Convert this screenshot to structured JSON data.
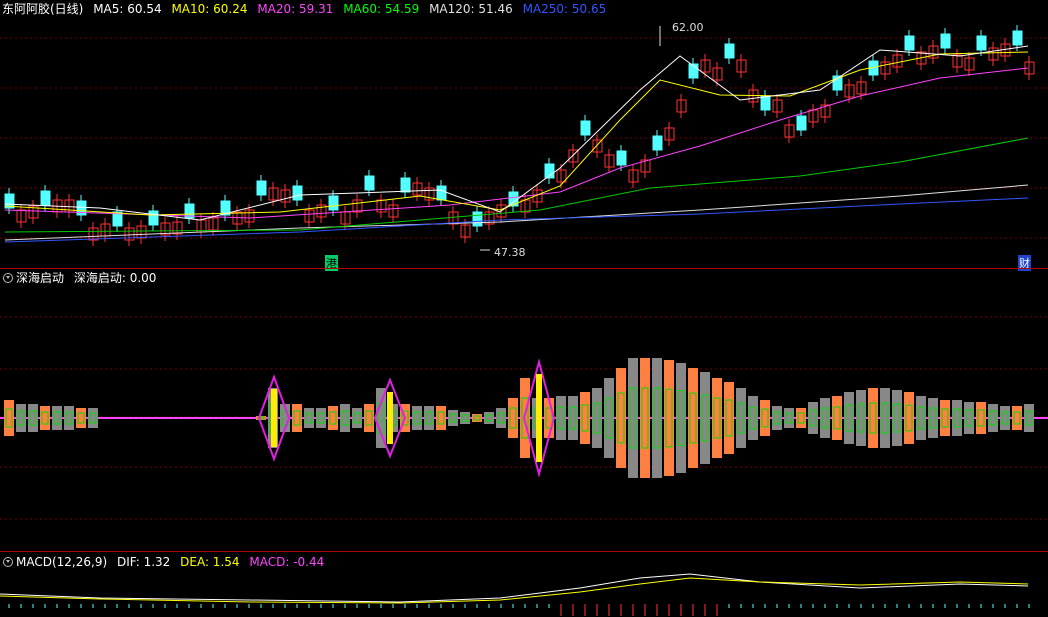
{
  "main_panel": {
    "stock_name": "东阿阿胶(日线)",
    "indicators": [
      {
        "label": "MA5: 60.54",
        "color": "#ffffff"
      },
      {
        "label": "MA10: 60.24",
        "color": "#ffff00"
      },
      {
        "label": "MA20: 59.31",
        "color": "#ff44ff"
      },
      {
        "label": "MA60: 54.59",
        "color": "#00ff00"
      },
      {
        "label": "MA120: 51.46",
        "color": "#e0e0e0"
      },
      {
        "label": "MA250: 50.65",
        "color": "#3355ff"
      }
    ],
    "high_label": "62.00",
    "low_label": "47.38",
    "marker_left": "港",
    "marker_right": "财"
  },
  "indicator_panel": {
    "name": "深海启动",
    "value_label": "深海启动: 0.00"
  },
  "macd_panel": {
    "name": "MACD(12,26,9)",
    "dif_label": "DIF: 1.32",
    "dea_label": "DEA: 1.54",
    "macd_label": "MACD: -0.44",
    "dif_color": "#ffffff",
    "dea_color": "#ffff00",
    "macd_color": "#ff44ff"
  },
  "colors": {
    "up": "#ff3333",
    "down": "#54ffff",
    "grid": "#7a0000",
    "separator": "#b00000"
  }
}
